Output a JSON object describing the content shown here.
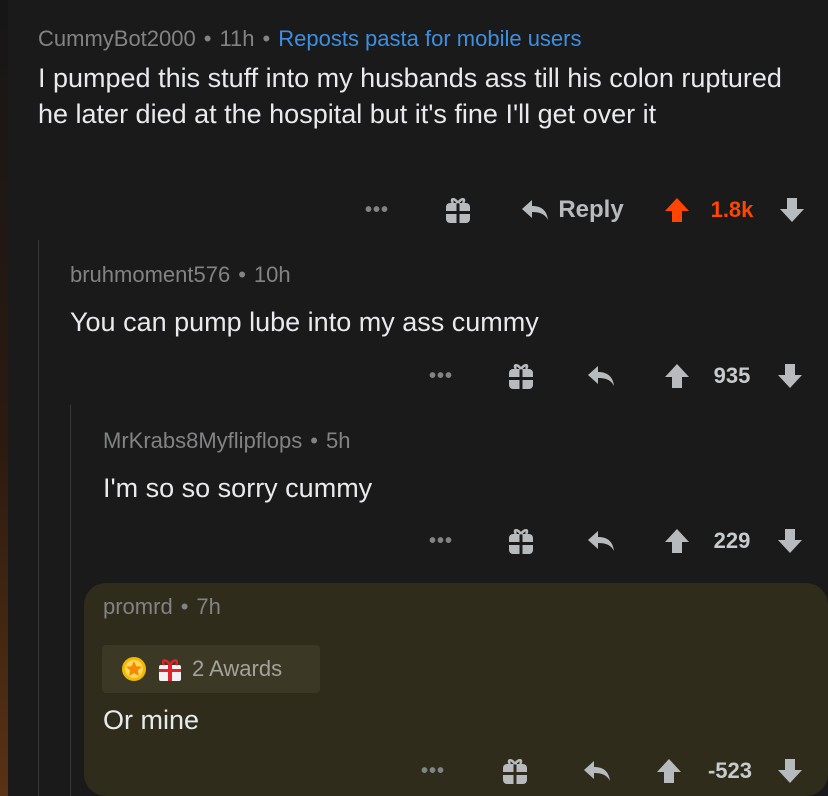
{
  "comments": [
    {
      "author": "CummyBot2000",
      "time": "11h",
      "flair": "Reposts pasta for mobile users",
      "body": "I pumped this stuff into my husbands ass till his colon ruptured he later died at the hospital but it's fine I'll get over it",
      "reply_label": "Reply",
      "score": "1.8k",
      "upvoted": true
    },
    {
      "author": "bruhmoment576",
      "time": "10h",
      "body": "You can pump lube into my ass cummy",
      "score": "935"
    },
    {
      "author": "MrKrabs8Myflipflops",
      "time": "5h",
      "body": "I'm so so sorry cummy",
      "score": "229"
    },
    {
      "author": "promrd",
      "time": "7h",
      "awards_label": "2 Awards",
      "body": "Or mine",
      "score": "-523",
      "highlighted": true
    }
  ],
  "separator": "•",
  "more_glyph": "•••",
  "colors": {
    "background": "#1a1a1b",
    "upvote_active": "#ff4500",
    "flair": "#3d8fe0",
    "highlight": "#2f2c1b"
  }
}
